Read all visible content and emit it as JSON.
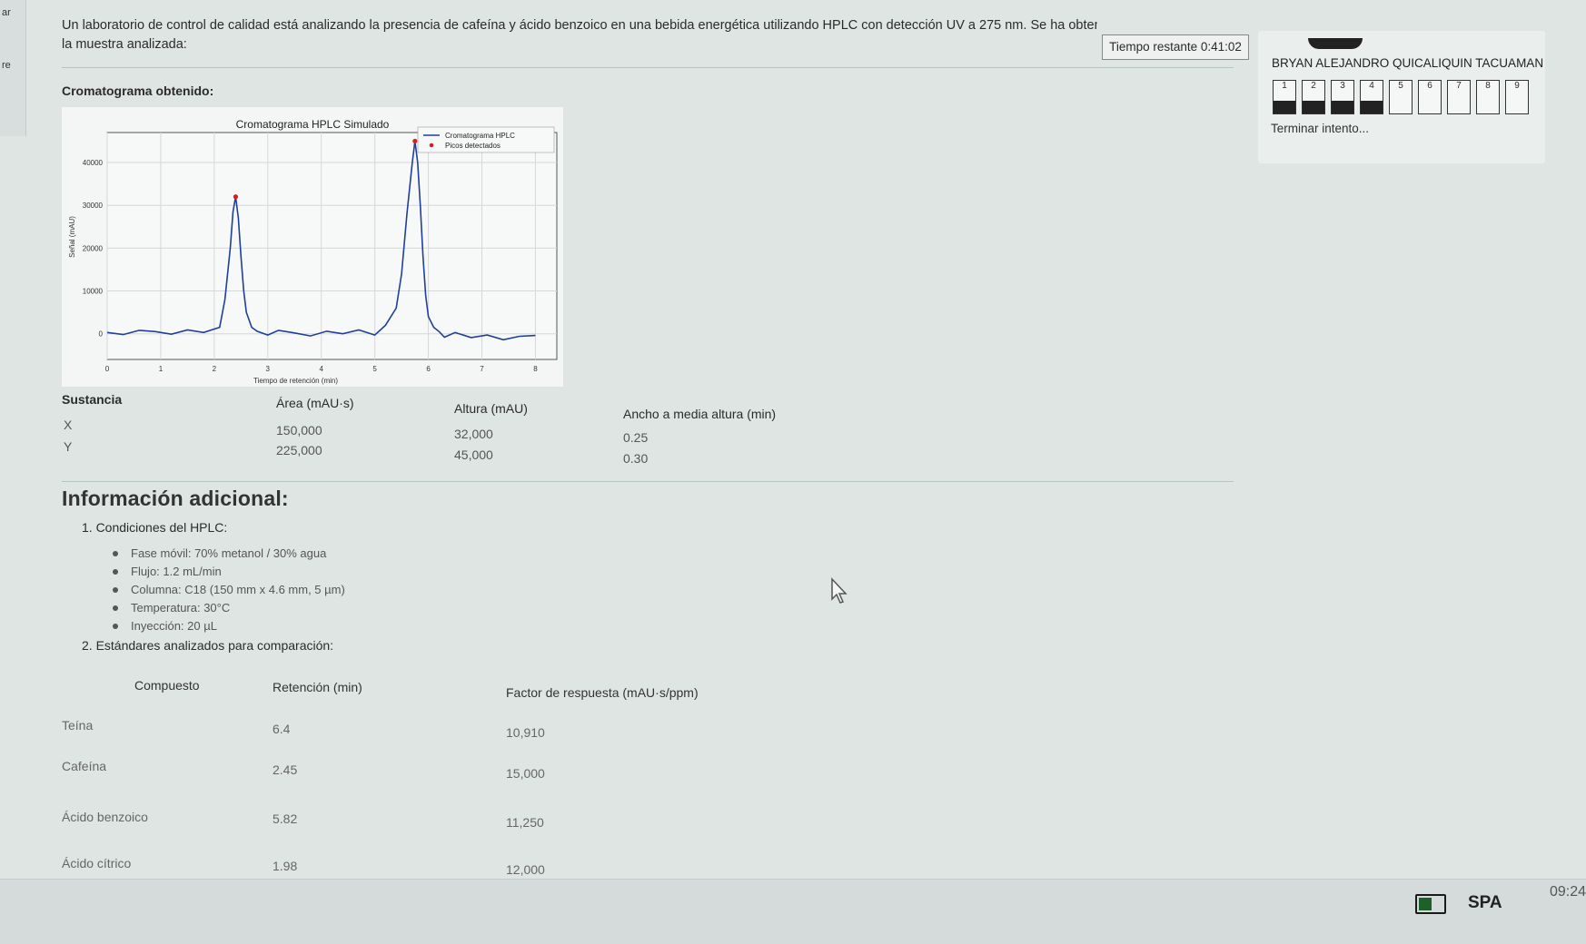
{
  "question": {
    "text_line1": "Un laboratorio de control de calidad está analizando la presencia de cafeína y ácido benzoico en una bebida energética utilizando HPLC con detección UV a 275 nm. Se ha obtenido el siguiente cromatograma de",
    "text_line2": "la muestra analizada:",
    "chromatogram_label": "Cromatograma obtenido:"
  },
  "chart_data": {
    "type": "line",
    "title": "Cromatograma HPLC Simulado",
    "xlabel": "Tiempo de retención (min)",
    "ylabel": "Señal (mAU)",
    "xlim": [
      0,
      8.4
    ],
    "ylim": [
      -6000,
      47000
    ],
    "x_ticks": [
      "0",
      "1",
      "2",
      "3",
      "4",
      "5",
      "6",
      "7",
      "8"
    ],
    "y_ticks": [
      "0",
      "10000",
      "20000",
      "30000",
      "40000"
    ],
    "grid": true,
    "legend_position": "top-right",
    "legend": [
      "Cromatograma HPLC",
      "Picos detectados"
    ],
    "series": [
      {
        "name": "Cromatograma HPLC",
        "x": [
          0,
          0.3,
          0.6,
          0.9,
          1.2,
          1.5,
          1.8,
          2.1,
          2.2,
          2.3,
          2.35,
          2.4,
          2.45,
          2.5,
          2.55,
          2.6,
          2.7,
          2.8,
          3.0,
          3.2,
          3.5,
          3.8,
          4.1,
          4.4,
          4.7,
          5.0,
          5.2,
          5.4,
          5.5,
          5.6,
          5.7,
          5.75,
          5.8,
          5.85,
          5.9,
          5.95,
          6.0,
          6.1,
          6.2,
          6.3,
          6.5,
          6.8,
          7.1,
          7.4,
          7.7,
          8.0
        ],
        "y": [
          300,
          -200,
          800,
          500,
          -100,
          900,
          300,
          1500,
          8000,
          20000,
          28500,
          32000,
          27000,
          18000,
          10000,
          5000,
          1500,
          600,
          -300,
          800,
          200,
          -500,
          600,
          0,
          900,
          -300,
          2000,
          6000,
          14000,
          28000,
          40000,
          45000,
          40000,
          30000,
          18000,
          9000,
          4000,
          1500,
          500,
          -800,
          300,
          -900,
          -300,
          -1400,
          -600,
          -400
        ]
      },
      {
        "name": "Picos detectados",
        "x": [
          2.4,
          5.75
        ],
        "y": [
          32000,
          45000
        ]
      }
    ]
  },
  "results_table": {
    "headers": [
      "Sustancia",
      "Área (mAU·s)",
      "Altura (mAU)",
      "Ancho a media altura (min)"
    ],
    "rows": [
      [
        "X",
        "150,000",
        "32,000",
        "0.25"
      ],
      [
        "Y",
        "225,000",
        "45,000",
        "0.30"
      ]
    ]
  },
  "additional_info": {
    "title": "Información adicional:",
    "conditions_title": "1. Condiciones del HPLC:",
    "conditions": [
      "Fase móvil: 70% metanol / 30% agua",
      "Flujo: 1.2 mL/min",
      "Columna: C18 (150 mm x 4.6 mm, 5 µm)",
      "Temperatura: 30°C",
      "Inyección: 20 µL"
    ],
    "standards_title": "2. Estándares analizados para comparación:",
    "standards_headers": [
      "Compuesto",
      "Retención (min)",
      "Factor de respuesta (mAU·s/ppm)"
    ],
    "standards_rows": [
      [
        "Teína",
        "6.4",
        "10,910"
      ],
      [
        "Cafeína",
        "2.45",
        "15,000"
      ],
      [
        "Ácido benzoico",
        "5.82",
        "11,250"
      ],
      [
        "Ácido cítrico",
        "1.98",
        "12,000"
      ]
    ]
  },
  "timer": {
    "label": "Tiempo restante 0:41:02"
  },
  "side_panel": {
    "user_name": "BRYAN ALEJANDRO QUICALIQUIN TACUAMAN",
    "nav_numbers": [
      "1",
      "2",
      "3",
      "4",
      "5",
      "6",
      "7",
      "8",
      "9"
    ],
    "nav_answered": [
      true,
      true,
      true,
      true,
      false,
      false,
      false,
      false,
      false
    ],
    "finish_label": "Terminar intento..."
  },
  "left_strip": {
    "top_text": "ar",
    "mid_text": "re"
  },
  "taskbar": {
    "language": "SPA",
    "clock": "09:24"
  },
  "colors": {
    "line": "#1f3f9a",
    "peak_marker": "#d62020",
    "background": "#dfe5e3"
  }
}
